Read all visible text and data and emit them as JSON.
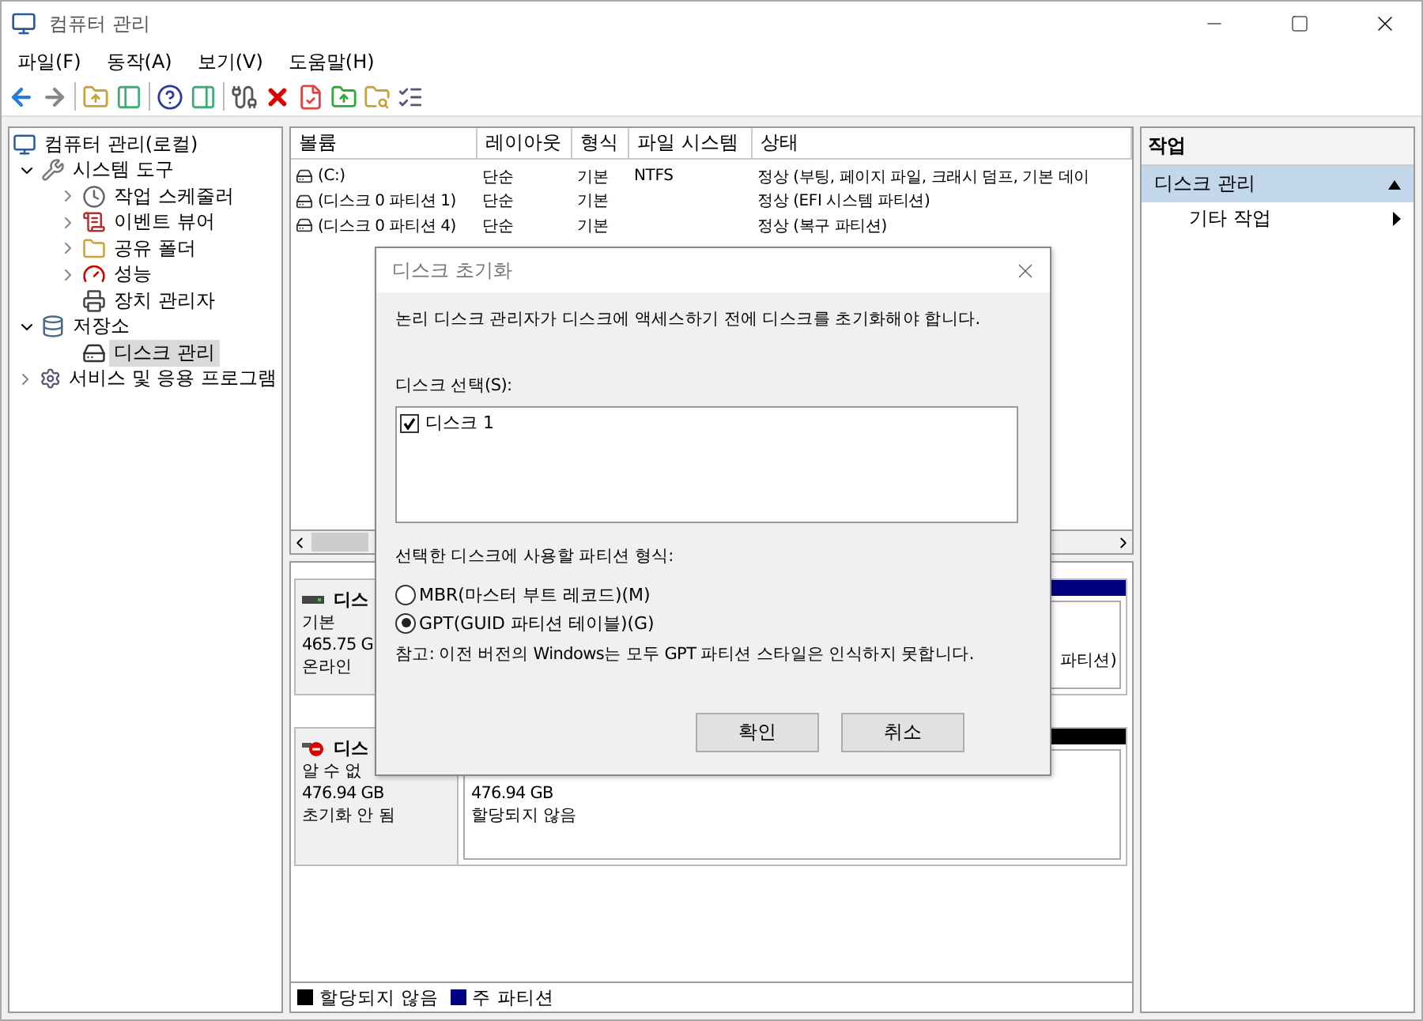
{
  "window": {
    "title": "컴퓨터 관리"
  },
  "menu": [
    "파일(F)",
    "동작(A)",
    "보기(V)",
    "도움말(H)"
  ],
  "tree": [
    {
      "label": "컴퓨터 관리(로컬)",
      "selected": false,
      "children": [
        {
          "label": "시스템 도구",
          "expanded": true,
          "selected": false,
          "children": [
            {
              "label": "작업 스케줄러",
              "expanded": false,
              "selected": false
            },
            {
              "label": "이벤트 뷰어",
              "expanded": false,
              "selected": false
            },
            {
              "label": "공유 폴더",
              "expanded": false,
              "selected": false
            },
            {
              "label": "성능",
              "expanded": false,
              "selected": false
            },
            {
              "label": "장치 관리자",
              "selected": false
            }
          ]
        },
        {
          "label": "저장소",
          "expanded": true,
          "selected": false,
          "children": [
            {
              "label": "디스크 관리",
              "selected": true
            }
          ]
        },
        {
          "label": "서비스 및 응용 프로그램",
          "expanded": false,
          "selected": false
        }
      ]
    }
  ],
  "volumes": {
    "columns": [
      "볼륨",
      "레이아웃",
      "형식",
      "파일 시스템",
      "상태"
    ],
    "rows": [
      {
        "cells": [
          "(C:)",
          "단순",
          "기본",
          "NTFS",
          "정상 (부팅, 페이지 파일, 크래시 덤프, 기본 데이"
        ]
      },
      {
        "cells": [
          "(디스크 0 파티션 1)",
          "단순",
          "기본",
          "",
          "정상 (EFI 시스템 파티션)"
        ]
      },
      {
        "cells": [
          "(디스크 0 파티션 4)",
          "단순",
          "기본",
          "",
          "정상 (복구 파티션)"
        ]
      }
    ]
  },
  "disks": [
    {
      "kind": "online",
      "name": "디스",
      "lines": [
        "기본",
        "465.75 G",
        "온라인"
      ],
      "partitions": [
        {
          "kind": "primary",
          "lines": [
            "파티션)"
          ]
        }
      ]
    },
    {
      "kind": "uninitialized",
      "name": "디스",
      "lines": [
        "알 수 없",
        "476.94 GB",
        "초기화 안 됨"
      ],
      "partitions": [
        {
          "kind": "unallocated",
          "lines": [
            "476.94 GB",
            "할당되지 않음"
          ]
        }
      ]
    }
  ],
  "legend": [
    {
      "label": "할당되지 않음",
      "color": "#000000"
    },
    {
      "label": "주 파티션",
      "color": "#000080"
    }
  ],
  "actions": {
    "title": "작업",
    "sections": [
      {
        "label": "디스크 관리",
        "selected": true,
        "items": [
          "기타 작업"
        ]
      }
    ]
  },
  "dialog": {
    "title": "디스크 초기화",
    "message": "논리 디스크 관리자가 디스크에 액세스하기 전에 디스크를 초기화해야 합니다.",
    "select_label": "디스크 선택(S):",
    "disks": [
      {
        "label": "디스크 1",
        "checked": true
      }
    ],
    "style_label": "선택한 디스크에 사용할 파티션 형식:",
    "styles": [
      {
        "label": "MBR(마스터 부트 레코드)(M)",
        "selected": false
      },
      {
        "label": "GPT(GUID 파티션 테이블)(G)",
        "selected": true
      }
    ],
    "note": "참고: 이전 버전의 Windows는 모두 GPT 파티션 스타일은 인식하지 못합니다.",
    "buttons": [
      "확인",
      "취소"
    ]
  }
}
